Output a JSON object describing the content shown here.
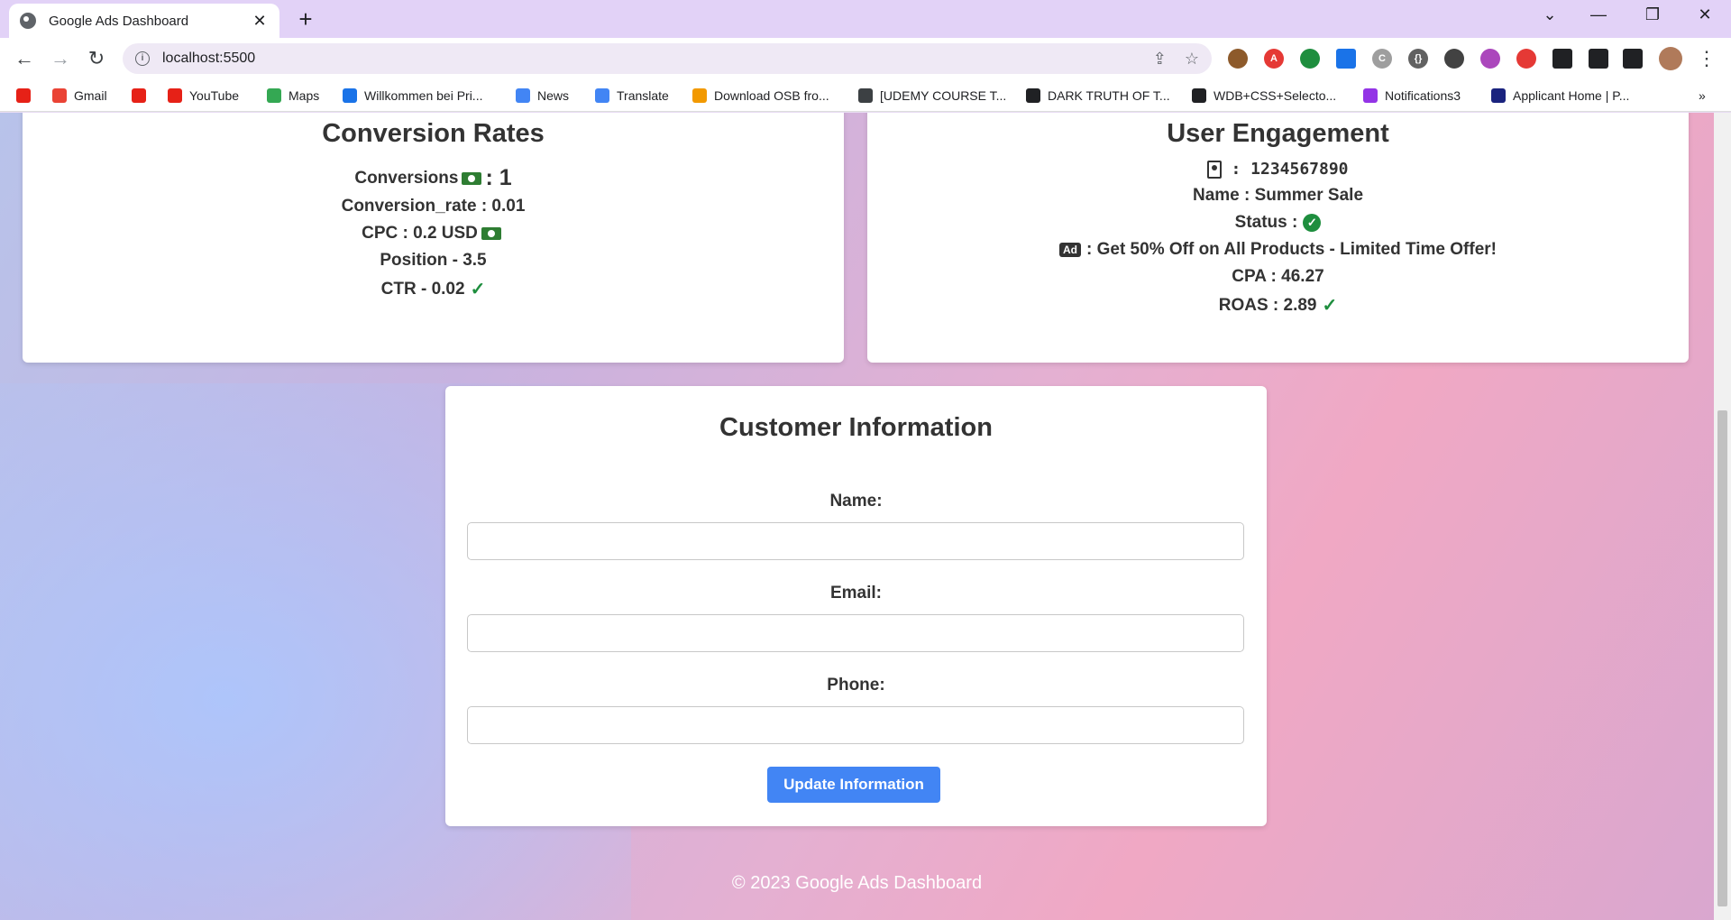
{
  "browser": {
    "tab_title": "Google Ads Dashboard",
    "url": "localhost:5500",
    "bookmarks": [
      {
        "label": "",
        "color": "#e62117"
      },
      {
        "label": "Gmail",
        "color": "#ea4335"
      },
      {
        "label": "",
        "color": "#e62117"
      },
      {
        "label": "YouTube",
        "color": "#e62117"
      },
      {
        "label": "Maps",
        "color": "#34a853"
      },
      {
        "label": "Willkommen bei Pri...",
        "color": "#1a73e8"
      },
      {
        "label": "News",
        "color": "#4285f4"
      },
      {
        "label": "Translate",
        "color": "#4285f4"
      },
      {
        "label": "Download OSB fro...",
        "color": "#f29900"
      },
      {
        "label": "[UDEMY COURSE T...",
        "color": "#3c4043"
      },
      {
        "label": "DARK TRUTH OF T...",
        "color": "#202124"
      },
      {
        "label": "WDB+CSS+Selecto...",
        "color": "#202124"
      },
      {
        "label": "Notifications3",
        "color": "#9334e6"
      },
      {
        "label": "Applicant Home | P...",
        "color": "#1a237e"
      }
    ]
  },
  "conversion": {
    "title": "Conversion Rates",
    "conversions_label": "Conversions",
    "conversions_value": ": 1",
    "conversion_rate": "Conversion_rate : 0.01",
    "cpc": "CPC : 0.2 USD",
    "position": "Position - 3.5",
    "ctr": "CTR - 0.02"
  },
  "engagement": {
    "title": "User Engagement",
    "id_value": ": 1234567890",
    "name": "Name : Summer Sale",
    "status_label": "Status :",
    "ad_badge": "Ad",
    "ad_text": ": Get 50% Off on All Products - Limited Time Offer!",
    "cpa": "CPA : 46.27",
    "roas": "ROAS : 2.89"
  },
  "customer": {
    "title": "Customer Information",
    "name_label": "Name:",
    "email_label": "Email:",
    "phone_label": "Phone:",
    "button": "Update Information"
  },
  "footer": "© 2023 Google Ads Dashboard"
}
